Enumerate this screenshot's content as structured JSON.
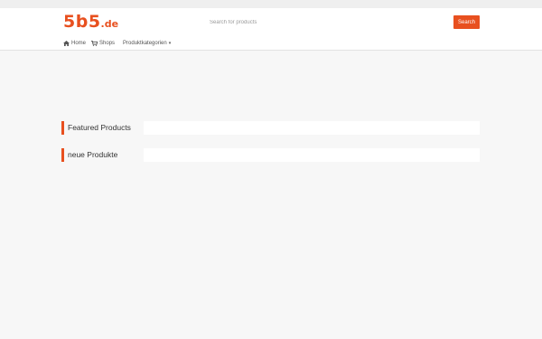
{
  "colors": {
    "accent": "#e8501f",
    "background": "#f7f7f7",
    "header": "#ffffff"
  },
  "logo": {
    "main": "5b5",
    "tld": ".de"
  },
  "search": {
    "placeholder": "Search for products",
    "button_label": "Search"
  },
  "nav": {
    "items": [
      {
        "label": "Home",
        "icon": "home-icon"
      },
      {
        "label": "Shops",
        "icon": "cart-icon"
      },
      {
        "label": "Produktkategorien",
        "icon": "chevron-down-icon"
      }
    ]
  },
  "sections": [
    {
      "title": "Featured Products"
    },
    {
      "title": "neue Produkte"
    }
  ]
}
